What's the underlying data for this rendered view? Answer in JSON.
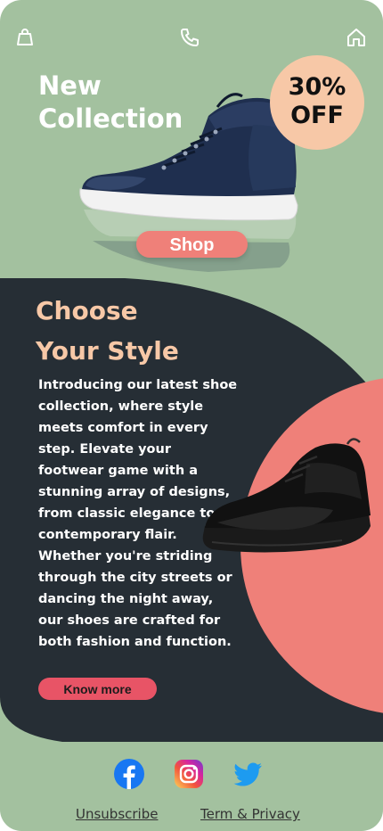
{
  "header": {
    "icons": [
      "shopping-bag-icon",
      "phone-icon",
      "home-icon"
    ]
  },
  "hero": {
    "headline_line1": "New",
    "headline_line2": "Collection",
    "badge_line1": "30%",
    "badge_line2": "OFF",
    "shop_label": "Shop"
  },
  "style_section": {
    "title_line1": "Choose",
    "title_line2": "Your Style",
    "body": "Introducing our latest shoe collection, where style meets comfort in every step. Elevate your footwear game with a stunning array of designs, from classic elegance to contemporary flair. Whether you're striding through the city streets or dancing the night away, our shoes are crafted for both fashion and function.",
    "cta_label": "Know more"
  },
  "footer": {
    "social_icons": [
      "facebook-icon",
      "instagram-icon",
      "twitter-icon"
    ],
    "unsubscribe_label": "Unsubscribe",
    "terms_label": "Term & Privacy"
  },
  "colors": {
    "background_green": "#a3c19f",
    "dark_panel": "#262e35",
    "accent_peach": "#f7c8a7",
    "accent_coral": "#ef8079",
    "button_pink": "#e85466"
  }
}
